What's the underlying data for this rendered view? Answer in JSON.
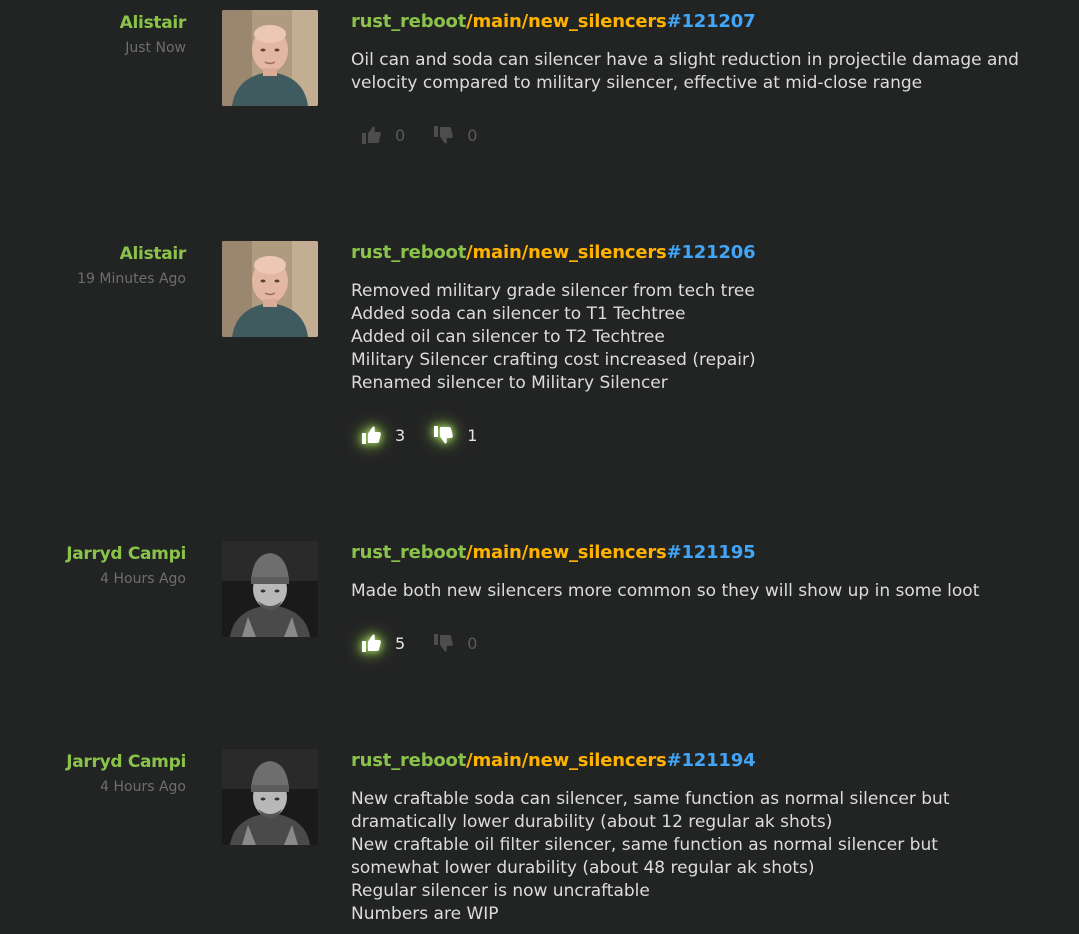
{
  "commits": [
    {
      "author": "Alistair",
      "time": "Just Now",
      "repo": "rust_reboot",
      "branch": "/main/new_silencers",
      "changeset": "#121207",
      "message_lines": [
        "Oil can and soda can silencer have a slight reduction in projectile damage and",
        "velocity compared to military silencer, effective at mid-close range"
      ],
      "likes": "0",
      "dislikes": "0",
      "likes_active": false,
      "dislikes_active": false,
      "avatar_icon": "bald-man-avatar-icon"
    },
    {
      "author": "Alistair",
      "time": "19 Minutes Ago",
      "repo": "rust_reboot",
      "branch": "/main/new_silencers",
      "changeset": "#121206",
      "message_lines": [
        "Removed military grade silencer from tech tree",
        "Added soda can silencer to T1 Techtree",
        "Added oil can silencer to T2 Techtree",
        "Military Silencer crafting cost increased (repair)",
        "Renamed silencer to Military Silencer"
      ],
      "likes": "3",
      "dislikes": "1",
      "likes_active": true,
      "dislikes_active": true,
      "avatar_icon": "bald-man-avatar-icon"
    },
    {
      "author": "Jarryd Campi",
      "time": "4 Hours Ago",
      "repo": "rust_reboot",
      "branch": "/main/new_silencers",
      "changeset": "#121195",
      "message_lines": [
        "Made both new silencers more common so they will show up in some loot"
      ],
      "likes": "5",
      "dislikes": "0",
      "likes_active": true,
      "dislikes_active": false,
      "avatar_icon": "beanie-man-avatar-icon"
    },
    {
      "author": "Jarryd Campi",
      "time": "4 Hours Ago",
      "repo": "rust_reboot",
      "branch": "/main/new_silencers",
      "changeset": "#121194",
      "message_lines": [
        "New craftable soda can silencer, same function as normal silencer but",
        "dramatically lower durability (about 12 regular ak shots)",
        "New craftable oil filter silencer, same function as normal silencer but",
        "somewhat lower durability (about 48 regular ak shots)",
        "Regular silencer is now uncraftable",
        "Numbers are WIP"
      ],
      "likes": "",
      "dislikes": "",
      "likes_active": false,
      "dislikes_active": false,
      "avatar_icon": "beanie-man-avatar-icon"
    }
  ]
}
